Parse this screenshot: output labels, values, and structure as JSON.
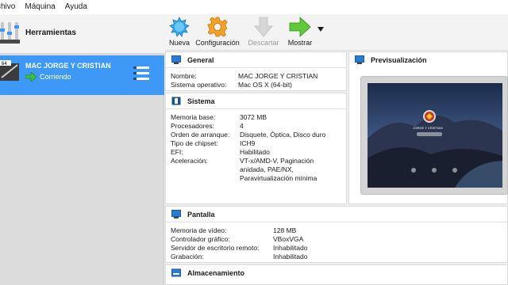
{
  "menubar": {
    "items": [
      "chivo",
      "Máquina",
      "Ayuda"
    ]
  },
  "sidebar": {
    "tools_label": "Herramientas",
    "vm": {
      "name": "MAC JORGE Y CRISTIAN",
      "state": "Corriendo",
      "os_badge": "64"
    }
  },
  "toolbar": {
    "new_label": "Nueva",
    "settings_label": "Configuración",
    "discard_label": "Descartar",
    "show_label": "Mostrar"
  },
  "general": {
    "title": "General",
    "rows": [
      {
        "key": "Nombre:",
        "value": "MAC JORGE Y CRISTIAN"
      },
      {
        "key": "Sistema operativo:",
        "value": "Mac OS X (64-bit)"
      }
    ]
  },
  "system": {
    "title": "Sistema",
    "rows": [
      {
        "key": "Memoria base:",
        "value": "3072 MB"
      },
      {
        "key": "Procesadores:",
        "value": "4"
      },
      {
        "key": "Orden de arranque:",
        "value": "Disquete, Óptica, Disco duro"
      },
      {
        "key": "Tipo de chipset:",
        "value": "ICH9"
      },
      {
        "key": "EFI:",
        "value": "Habilitado"
      },
      {
        "key": "Aceleración:",
        "value": "VT-x/AMD-V, Paginación"
      }
    ],
    "accel_extra": [
      "anidada, PAE/NX,",
      "Paravirtualización mínima"
    ]
  },
  "preview": {
    "title": "Previsualización",
    "login_name": "JORGE Y CRISTIAN"
  },
  "display": {
    "title": "Pantalla",
    "rows": [
      {
        "key": "Memoria de vídeo:",
        "value": "128 MB"
      },
      {
        "key": "Controlador gráfico:",
        "value": "VBoxVGA"
      },
      {
        "key": "Servidor de escritorio remoto:",
        "value": "Inhabilitado"
      },
      {
        "key": "Grabación:",
        "value": "Inhabilitado"
      }
    ]
  },
  "storage": {
    "title": "Almacenamiento"
  },
  "colors": {
    "accent": "#3d99f5",
    "panel_icon": "#2a7bd4"
  }
}
